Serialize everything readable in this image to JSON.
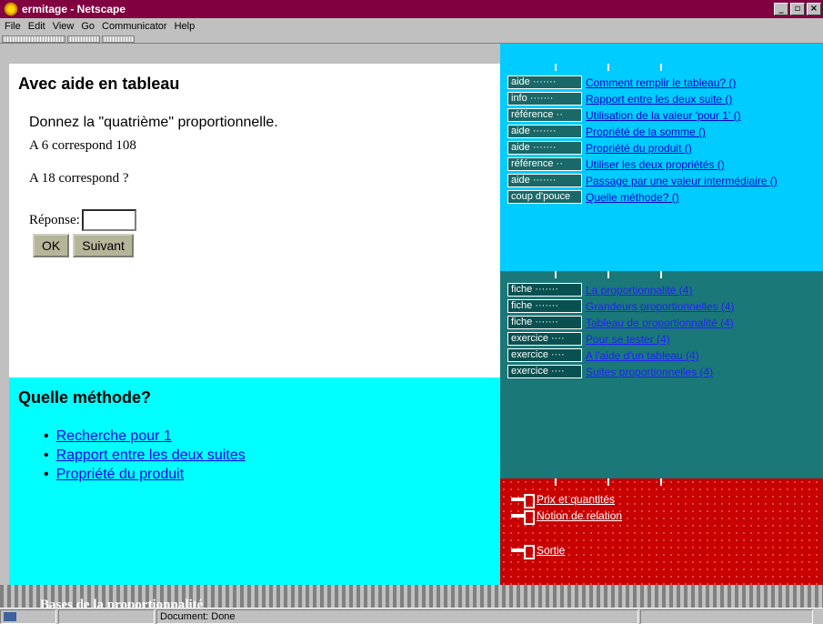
{
  "window": {
    "title": "ermitage - Netscape",
    "buttons": [
      "_",
      "▫",
      "×"
    ]
  },
  "menu": [
    "File",
    "Edit",
    "View",
    "Go",
    "Communicator",
    "Help"
  ],
  "main": {
    "title": "Avec aide en tableau",
    "question": "Donnez la \"quatrième\" proportionnelle.",
    "line1": "A 6 correspond 108",
    "line2": "A 18 correspond ?",
    "answer_label": "Réponse:",
    "answer_value": "",
    "ok_label": "OK",
    "next_label": "Suivant"
  },
  "method": {
    "title": "Quelle méthode?",
    "items": [
      "Recherche pour 1",
      "Rapport entre les deux suites",
      "Propriété du produit"
    ]
  },
  "aide": {
    "items": [
      {
        "tag": "aide ·······",
        "label": "Comment remplir le tableau? ()"
      },
      {
        "tag": "info ·······",
        "label": "Rapport entre les deux suite ()"
      },
      {
        "tag": "référence ··",
        "label": "Utilisation de la valeur 'pour 1' ()"
      },
      {
        "tag": "aide ·······",
        "label": "Propriété de la somme ()"
      },
      {
        "tag": "aide ·······",
        "label": "Propriété du produit ()"
      },
      {
        "tag": "référence ··",
        "label": "Utiliser les deux propriétés ()"
      },
      {
        "tag": "aide ·······",
        "label": "Passage par une valeur intermédiaire ()"
      },
      {
        "tag": "coup d'pouce",
        "label": "Quelle méthode? ()"
      }
    ]
  },
  "fiches": {
    "items": [
      {
        "tag": "fiche ·······",
        "label": "La proportionnalité (4)"
      },
      {
        "tag": "fiche ·······",
        "label": "Grandeurs proportionnelles (4)"
      },
      {
        "tag": "fiche ·······",
        "label": "Tableau de proportionnalité (4)"
      },
      {
        "tag": "exercice ····",
        "label": "Pour se tester (4)"
      },
      {
        "tag": "exercice ····",
        "label": "A l'aide d'un tableau (4)"
      },
      {
        "tag": "exercice ····",
        "label": "Suites proportionnelles (4)"
      }
    ]
  },
  "nav": {
    "items": [
      "Prix et quantités",
      "Notion de relation"
    ],
    "exit": "Sortie"
  },
  "banner": {
    "title": "Bases de la proportionnalité"
  },
  "status": {
    "text": "Document: Done"
  }
}
